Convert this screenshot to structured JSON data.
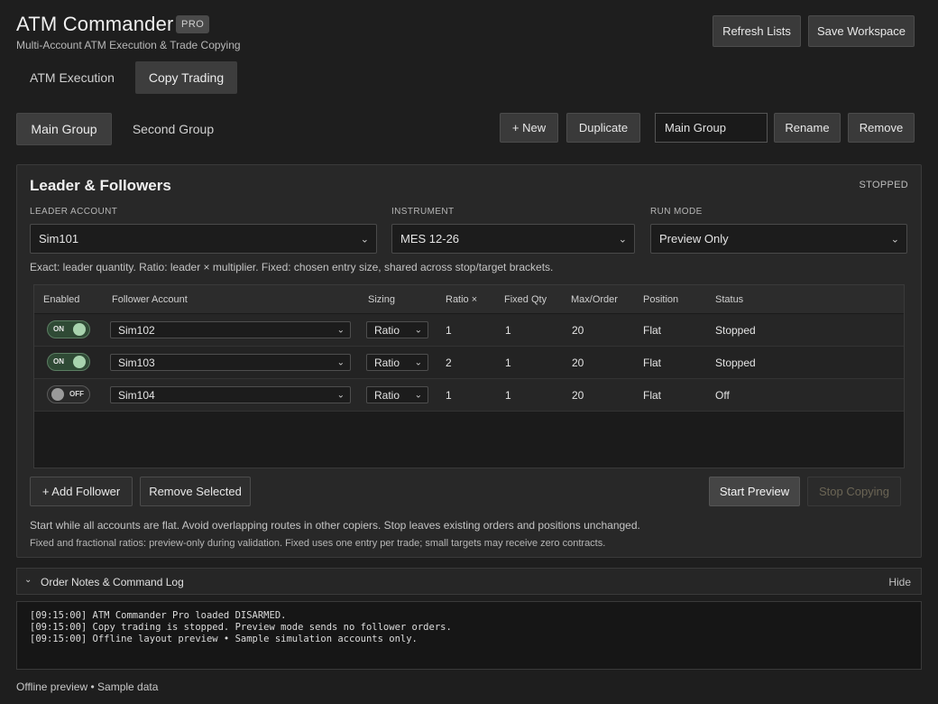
{
  "header": {
    "title": "ATM Commander",
    "badge": "PRO",
    "subtitle": "Multi-Account ATM Execution & Trade Copying",
    "refresh_label": "Refresh Lists",
    "save_label": "Save Workspace"
  },
  "tabs": [
    {
      "label": "ATM Execution",
      "active": false
    },
    {
      "label": "Copy Trading",
      "active": true
    }
  ],
  "groups": {
    "tabs": [
      {
        "label": "Main Group",
        "active": true
      },
      {
        "label": "Second Group",
        "active": false
      }
    ],
    "new_label": "+ New",
    "duplicate_label": "Duplicate",
    "name_value": "Main Group",
    "rename_label": "Rename",
    "remove_label": "Remove"
  },
  "panel": {
    "title": "Leader & Followers",
    "state": "STOPPED",
    "leader_label": "LEADER ACCOUNT",
    "leader_value": "Sim101",
    "instrument_label": "INSTRUMENT",
    "instrument_value": "MES 12-26",
    "runmode_label": "RUN MODE",
    "runmode_value": "Preview Only",
    "hint": "Exact: leader quantity. Ratio: leader × multiplier. Fixed: chosen entry size, shared across stop/target brackets."
  },
  "table": {
    "columns": [
      "Enabled",
      "Follower Account",
      "Sizing",
      "Ratio ×",
      "Fixed Qty",
      "Max/Order",
      "Position",
      "Status"
    ],
    "rows": [
      {
        "enabled": "ON",
        "account": "Sim102",
        "sizing": "Ratio",
        "ratio": "1",
        "fixed": "1",
        "max": "20",
        "position": "Flat",
        "status": "Stopped"
      },
      {
        "enabled": "ON",
        "account": "Sim103",
        "sizing": "Ratio",
        "ratio": "2",
        "fixed": "1",
        "max": "20",
        "position": "Flat",
        "status": "Stopped"
      },
      {
        "enabled": "OFF",
        "account": "Sim104",
        "sizing": "Ratio",
        "ratio": "1",
        "fixed": "1",
        "max": "20",
        "position": "Flat",
        "status": "Off"
      }
    ]
  },
  "actions": {
    "add_follower": "+ Add Follower",
    "remove_selected": "Remove Selected",
    "start_preview": "Start Preview",
    "stop_copying": "Stop Copying"
  },
  "notes": {
    "line1": "Start while all accounts are flat. Avoid overlapping routes in other copiers. Stop leaves existing orders and positions unchanged.",
    "line2": "Fixed and fractional ratios: preview-only during validation. Fixed uses one entry per trade; small targets may receive zero contracts."
  },
  "log": {
    "title": "Order Notes & Command Log",
    "hide_label": "Hide",
    "lines": [
      "[09:15:00] ATM Commander Pro loaded DISARMED.",
      "[09:15:00] Copy trading is stopped. Preview mode sends no follower orders.",
      "[09:15:00] Offline layout preview • Sample simulation accounts only."
    ]
  },
  "footer": "Offline preview • Sample data",
  "icons": {
    "chevron": "chevron-down-icon",
    "toggle": "toggle-switch"
  },
  "colors": {
    "background": "#1e1e1e",
    "panel": "#282828",
    "toggle_on": "#2f4a35",
    "knob_on": "#a8d3ae"
  }
}
